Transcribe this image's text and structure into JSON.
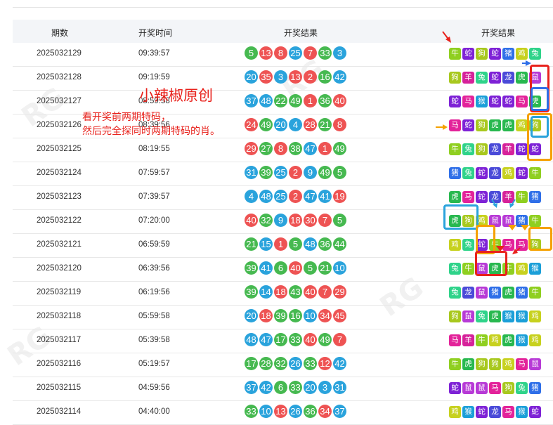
{
  "headers": {
    "issue": "期数",
    "time": "开奖时间",
    "result1": "开奖结果",
    "result2": "开奖结果"
  },
  "colors": {
    "red": "#ee5353",
    "blue": "#2aa3dc",
    "green": "#46b950"
  },
  "zodiac_colors": {
    "牛": "#8fcf20",
    "蛇": "#7e22d6",
    "狗": "#a8c81e",
    "猪": "#2f6fe8",
    "鸡": "#c7d11e",
    "兔": "#2fd38a",
    "羊": "#d6229a",
    "龙": "#4a4ad8",
    "虎": "#28b84f",
    "鼠": "#b73ad6",
    "马": "#e3239a",
    "猴": "#1b9fd8"
  },
  "rows": [
    {
      "issue": "2025032129",
      "time": "09:39:57",
      "balls": [
        [
          "5",
          "green"
        ],
        [
          "13",
          "red"
        ],
        [
          "8",
          "red"
        ],
        [
          "25",
          "blue"
        ],
        [
          "7",
          "red"
        ],
        [
          "33",
          "green"
        ],
        [
          "3",
          "blue"
        ]
      ],
      "zodiac": [
        "牛",
        "蛇",
        "狗",
        "蛇",
        "猪",
        "鸡",
        "兔"
      ]
    },
    {
      "issue": "2025032128",
      "time": "09:19:59",
      "balls": [
        [
          "20",
          "blue"
        ],
        [
          "35",
          "red"
        ],
        [
          "3",
          "blue"
        ],
        [
          "13",
          "red"
        ],
        [
          "2",
          "red"
        ],
        [
          "16",
          "green"
        ],
        [
          "42",
          "blue"
        ]
      ],
      "zodiac": [
        "狗",
        "羊",
        "兔",
        "蛇",
        "龙",
        "虎",
        "鼠"
      ]
    },
    {
      "issue": "2025032127",
      "time": "08:59:58",
      "balls": [
        [
          "37",
          "blue"
        ],
        [
          "48",
          "blue"
        ],
        [
          "22",
          "green"
        ],
        [
          "49",
          "green"
        ],
        [
          "1",
          "red"
        ],
        [
          "36",
          "green"
        ],
        [
          "40",
          "red"
        ]
      ],
      "zodiac": [
        "蛇",
        "马",
        "猴",
        "蛇",
        "蛇",
        "马",
        "虎"
      ]
    },
    {
      "issue": "2025032126",
      "time": "08:39:56",
      "balls": [
        [
          "24",
          "red"
        ],
        [
          "49",
          "green"
        ],
        [
          "20",
          "blue"
        ],
        [
          "4",
          "blue"
        ],
        [
          "28",
          "red"
        ],
        [
          "21",
          "green"
        ],
        [
          "8",
          "red"
        ]
      ],
      "zodiac": [
        "马",
        "蛇",
        "狗",
        "虎",
        "虎",
        "鸡",
        "狗"
      ]
    },
    {
      "issue": "2025032125",
      "time": "08:19:55",
      "balls": [
        [
          "29",
          "red"
        ],
        [
          "27",
          "green"
        ],
        [
          "8",
          "red"
        ],
        [
          "38",
          "green"
        ],
        [
          "47",
          "blue"
        ],
        [
          "1",
          "red"
        ],
        [
          "49",
          "green"
        ]
      ],
      "zodiac": [
        "牛",
        "兔",
        "狗",
        "龙",
        "羊",
        "蛇",
        "蛇"
      ]
    },
    {
      "issue": "2025032124",
      "time": "07:59:57",
      "balls": [
        [
          "31",
          "blue"
        ],
        [
          "39",
          "green"
        ],
        [
          "25",
          "blue"
        ],
        [
          "2",
          "red"
        ],
        [
          "9",
          "blue"
        ],
        [
          "49",
          "green"
        ],
        [
          "5",
          "green"
        ]
      ],
      "zodiac": [
        "猪",
        "兔",
        "蛇",
        "龙",
        "鸡",
        "蛇",
        "牛"
      ]
    },
    {
      "issue": "2025032123",
      "time": "07:39:57",
      "balls": [
        [
          "4",
          "blue"
        ],
        [
          "48",
          "blue"
        ],
        [
          "25",
          "blue"
        ],
        [
          "2",
          "red"
        ],
        [
          "47",
          "blue"
        ],
        [
          "41",
          "blue"
        ],
        [
          "19",
          "red"
        ]
      ],
      "zodiac": [
        "虎",
        "马",
        "蛇",
        "龙",
        "羊",
        "牛",
        "猪"
      ]
    },
    {
      "issue": "2025032122",
      "time": "07:20:00",
      "balls": [
        [
          "40",
          "red"
        ],
        [
          "32",
          "green"
        ],
        [
          "9",
          "blue"
        ],
        [
          "18",
          "red"
        ],
        [
          "30",
          "red"
        ],
        [
          "7",
          "red"
        ],
        [
          "5",
          "green"
        ]
      ],
      "zodiac": [
        "虎",
        "狗",
        "鸡",
        "鼠",
        "鼠",
        "猪",
        "牛"
      ]
    },
    {
      "issue": "2025032121",
      "time": "06:59:59",
      "balls": [
        [
          "21",
          "green"
        ],
        [
          "15",
          "blue"
        ],
        [
          "1",
          "red"
        ],
        [
          "5",
          "green"
        ],
        [
          "48",
          "blue"
        ],
        [
          "36",
          "green"
        ],
        [
          "44",
          "green"
        ]
      ],
      "zodiac": [
        "鸡",
        "兔",
        "蛇",
        "牛",
        "马",
        "马",
        "狗"
      ]
    },
    {
      "issue": "2025032120",
      "time": "06:39:56",
      "balls": [
        [
          "39",
          "green"
        ],
        [
          "41",
          "blue"
        ],
        [
          "6",
          "green"
        ],
        [
          "40",
          "red"
        ],
        [
          "5",
          "green"
        ],
        [
          "21",
          "green"
        ],
        [
          "10",
          "blue"
        ]
      ],
      "zodiac": [
        "兔",
        "牛",
        "鼠",
        "虎",
        "牛",
        "鸡",
        "猴"
      ]
    },
    {
      "issue": "2025032119",
      "time": "06:19:56",
      "balls": [
        [
          "39",
          "green"
        ],
        [
          "14",
          "blue"
        ],
        [
          "18",
          "red"
        ],
        [
          "43",
          "green"
        ],
        [
          "40",
          "red"
        ],
        [
          "7",
          "red"
        ],
        [
          "29",
          "red"
        ]
      ],
      "zodiac": [
        "兔",
        "龙",
        "鼠",
        "猪",
        "虎",
        "猪",
        "牛"
      ]
    },
    {
      "issue": "2025032118",
      "time": "05:59:58",
      "balls": [
        [
          "20",
          "blue"
        ],
        [
          "18",
          "red"
        ],
        [
          "39",
          "green"
        ],
        [
          "16",
          "green"
        ],
        [
          "10",
          "blue"
        ],
        [
          "34",
          "red"
        ],
        [
          "45",
          "red"
        ]
      ],
      "zodiac": [
        "狗",
        "鼠",
        "兔",
        "虎",
        "猴",
        "猴",
        "鸡"
      ]
    },
    {
      "issue": "2025032117",
      "time": "05:39:58",
      "balls": [
        [
          "48",
          "blue"
        ],
        [
          "47",
          "blue"
        ],
        [
          "17",
          "green"
        ],
        [
          "33",
          "green"
        ],
        [
          "40",
          "red"
        ],
        [
          "49",
          "green"
        ],
        [
          "7",
          "red"
        ]
      ],
      "zodiac": [
        "马",
        "羊",
        "牛",
        "鸡",
        "虎",
        "猴",
        "鸡"
      ]
    },
    {
      "issue": "2025032116",
      "time": "05:19:57",
      "balls": [
        [
          "17",
          "green"
        ],
        [
          "28",
          "green"
        ],
        [
          "32",
          "green"
        ],
        [
          "26",
          "blue"
        ],
        [
          "33",
          "green"
        ],
        [
          "12",
          "red"
        ],
        [
          "42",
          "blue"
        ]
      ],
      "zodiac": [
        "牛",
        "虎",
        "狗",
        "狗",
        "鸡",
        "马",
        "鼠"
      ]
    },
    {
      "issue": "2025032115",
      "time": "04:59:56",
      "balls": [
        [
          "37",
          "blue"
        ],
        [
          "42",
          "blue"
        ],
        [
          "6",
          "green"
        ],
        [
          "33",
          "green"
        ],
        [
          "20",
          "blue"
        ],
        [
          "3",
          "blue"
        ],
        [
          "31",
          "blue"
        ]
      ],
      "zodiac": [
        "蛇",
        "鼠",
        "鼠",
        "马",
        "狗",
        "兔",
        "猪"
      ]
    },
    {
      "issue": "2025032114",
      "time": "04:40:00",
      "balls": [
        [
          "33",
          "green"
        ],
        [
          "10",
          "blue"
        ],
        [
          "13",
          "red"
        ],
        [
          "26",
          "blue"
        ],
        [
          "36",
          "green"
        ],
        [
          "34",
          "red"
        ],
        [
          "37",
          "blue"
        ]
      ],
      "zodiac": [
        "鸡",
        "猴",
        "蛇",
        "龙",
        "马",
        "猴",
        "蛇"
      ]
    }
  ],
  "annotations": {
    "title": "小辣椒原创",
    "line1": "看开奖前两期特码，",
    "line2": "然后完全探同时两期特码的肖。"
  }
}
